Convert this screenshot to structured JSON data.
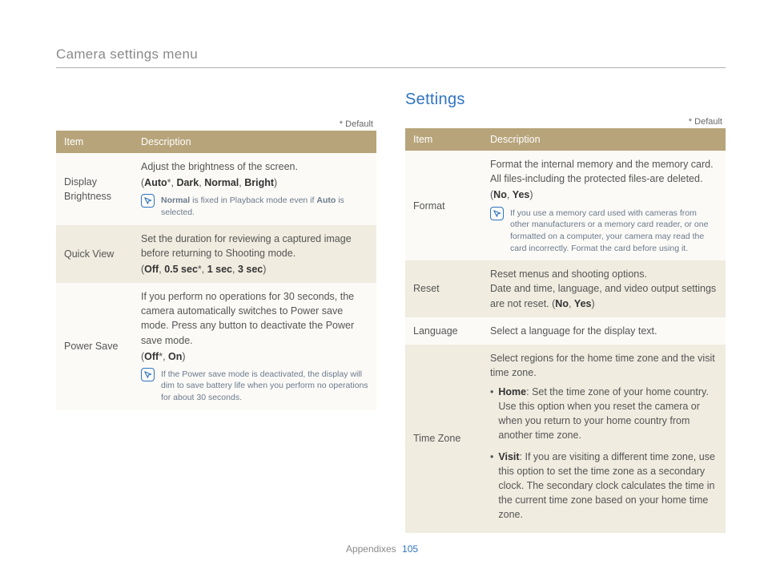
{
  "page_title": "Camera settings menu",
  "section_heading": "Settings",
  "default_label": "* Default",
  "footer": {
    "section": "Appendixes",
    "page": "105"
  },
  "headers": {
    "item": "Item",
    "description": "Description"
  },
  "left_rows": [
    {
      "item": "Display Brightness",
      "desc": "Adjust the brightness of the screen.",
      "options_html": "(<b>Auto</b>*, <b>Dark</b>, <b>Normal</b>, <b>Bright</b>)",
      "note": "Normal is fixed in Playback mode even if Auto is selected.",
      "note_bold": [
        "Normal",
        "Auto"
      ]
    },
    {
      "item": "Quick View",
      "desc": "Set the duration for reviewing a captured image before returning to Shooting mode.",
      "options_html": "(<b>Off</b>, <b>0.5 sec</b>*, <b>1 sec</b>, <b>3 sec</b>)"
    },
    {
      "item": "Power Save",
      "desc": "If you perform no operations for 30 seconds, the camera automatically switches to Power save mode. Press any button to deactivate the Power save mode.",
      "options_html": "(<b>Off</b>*, <b>On</b>)",
      "note": "If the Power save mode is deactivated, the display will dim to save battery life when you perform no operations for about 30 seconds."
    }
  ],
  "right_rows": [
    {
      "item": "Format",
      "desc": "Format the internal memory and the memory card. All files-including the protected files-are deleted.",
      "options_html": "(<b>No</b>, <b>Yes</b>)",
      "note": "If you use a memory card used with cameras from other manufacturers or a memory card reader, or one formatted on a computer, your camera may read the card incorrectly. Format the card before using it."
    },
    {
      "item": "Reset",
      "desc": "Reset menus and shooting options.\nDate and time, language, and video output settings are not reset.",
      "options_inline_html": " (<b>No</b>, <b>Yes</b>)"
    },
    {
      "item": "Language",
      "desc": "Select a language for the display text."
    },
    {
      "item": "Time Zone",
      "desc": "Select regions for the home time zone and the visit time zone.",
      "bullets": [
        {
          "label": "Home",
          "text": ": Set the time zone of your home country. Use this option when you reset the camera or when you return to your home country from another time zone."
        },
        {
          "label": "Visit",
          "text": ": If you are visiting a different time zone, use this option to set the time zone as a secondary clock. The secondary clock calculates the time in the current time zone based on your home time zone."
        }
      ]
    }
  ]
}
